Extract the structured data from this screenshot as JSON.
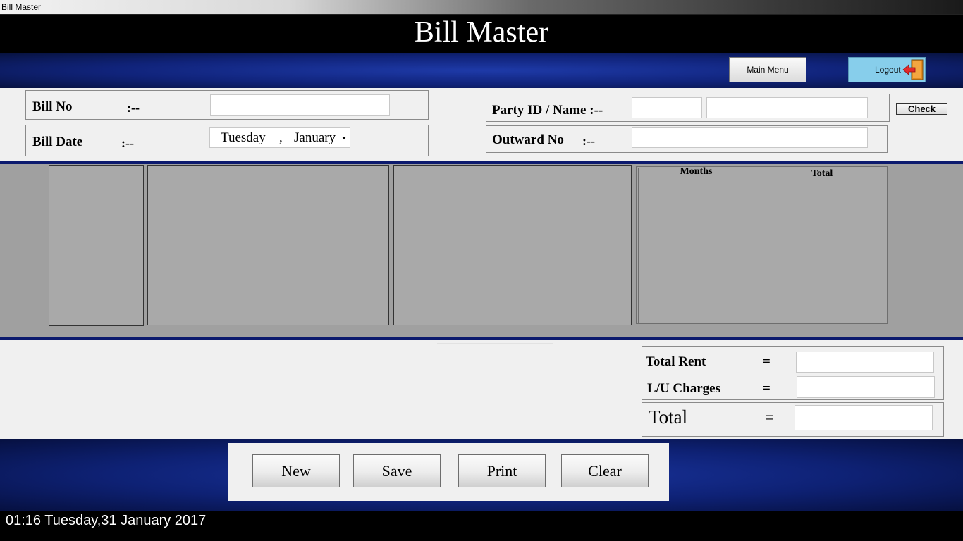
{
  "window": {
    "title": "Bill Master"
  },
  "header": {
    "title": "Bill Master"
  },
  "nav": {
    "main_menu_label": "Main Menu",
    "logout_label": "Logout"
  },
  "form": {
    "bill_no_label": "Bill No",
    "bill_no_sep": ":--",
    "bill_no_value": "",
    "bill_date_label": "Bill Date",
    "bill_date_sep": ":--",
    "bill_date_day": "Tuesday",
    "bill_date_comma": ",",
    "bill_date_month": "January",
    "party_label": "Party ID / Name :--",
    "party_id_value": "",
    "party_name_value": "",
    "check_label": "Check",
    "outward_label": "Outward No",
    "outward_sep": ":--",
    "outward_value": ""
  },
  "grid": {
    "months_header": "Months",
    "total_header": "Total"
  },
  "totals": {
    "total_rent_label": "Total Rent",
    "lu_charges_label": "L/U Charges",
    "total_label": "Total",
    "equals": "="
  },
  "actions": {
    "new_label": "New",
    "save_label": "Save",
    "print_label": "Print",
    "clear_label": "Clear"
  },
  "status": {
    "datetime": "01:16 Tuesday,31 January 2017"
  },
  "colors": {
    "header_black": "#000000",
    "band_blue": "#10237a",
    "logout_bg": "#87ceeb",
    "grid_gray": "#a9a9a9"
  }
}
